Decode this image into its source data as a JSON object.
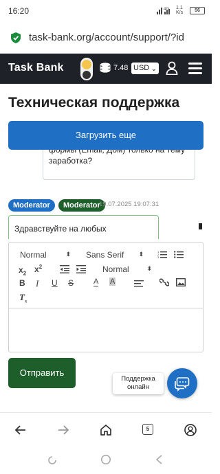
{
  "status_bar": {
    "time": "16:20",
    "network": "4G",
    "speed": "1.1 K/s",
    "battery": "56"
  },
  "browser": {
    "url": "task-bank.org/account/support/?id"
  },
  "header": {
    "brand": "Task Bank",
    "balance": "7.48",
    "currency": "USD"
  },
  "page": {
    "title": "Техническая поддержка",
    "load_more_label": "Загрузить еще"
  },
  "messages": {
    "user_message_text": "формы (Email, Дом) только на тему заработка?",
    "badges": [
      "Moderator",
      "Moderator"
    ],
    "moderator_time": "19.07.2025 19:07:31",
    "moderator_text": "Здравствуйте на любых"
  },
  "editor": {
    "header_select": "Normal",
    "font_select": "Sans Serif",
    "size_select": "Normal",
    "body_text": ""
  },
  "send_label": "Отправить",
  "support_widget": {
    "label_line1": "Поддержка",
    "label_line2": "онлайн"
  },
  "browser_nav": {
    "tab_count": "5"
  },
  "colors": {
    "header_bg": "#1f2129",
    "primary_blue": "#1f6fc4",
    "moderator_green": "#1d5e2a"
  }
}
